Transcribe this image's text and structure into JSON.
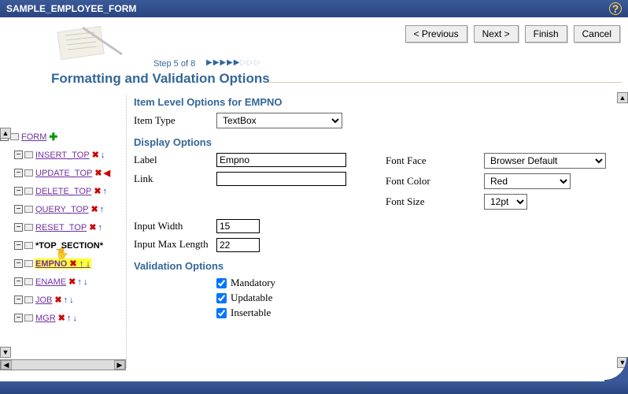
{
  "titlebar": {
    "title": "SAMPLE_EMPLOYEE_FORM"
  },
  "nav": {
    "previous": "< Previous",
    "next": "Next >",
    "finish": "Finish",
    "cancel": "Cancel"
  },
  "step": {
    "label": "Step 5 of 8"
  },
  "page_title": "Formatting and Validation Options",
  "tree": {
    "root": {
      "label": "FORM"
    },
    "items": [
      {
        "label": "INSERT_TOP"
      },
      {
        "label": "UPDATE_TOP"
      },
      {
        "label": "DELETE_TOP"
      },
      {
        "label": "QUERY_TOP"
      },
      {
        "label": "RESET_TOP"
      },
      {
        "label": "*TOP_SECTION*"
      },
      {
        "label": "EMPNO"
      },
      {
        "label": "ENAME"
      },
      {
        "label": "JOB"
      },
      {
        "label": "MGR"
      }
    ]
  },
  "section": {
    "item_level": "Item Level Options for EMPNO",
    "display": "Display Options",
    "validation": "Validation Options"
  },
  "form": {
    "item_type_label": "Item Type",
    "item_type_value": "TextBox",
    "label_label": "Label",
    "label_value": "Empno",
    "link_label": "Link",
    "link_value": "",
    "font_face_label": "Font Face",
    "font_face_value": "Browser Default",
    "font_color_label": "Font Color",
    "font_color_value": "Red",
    "font_size_label": "Font Size",
    "font_size_value": "12pt",
    "input_width_label": "Input Width",
    "input_width_value": "15",
    "input_maxlen_label": "Input Max Length",
    "input_maxlen_value": "22",
    "mandatory_label": "Mandatory",
    "updatable_label": "Updatable",
    "insertable_label": "Insertable"
  }
}
